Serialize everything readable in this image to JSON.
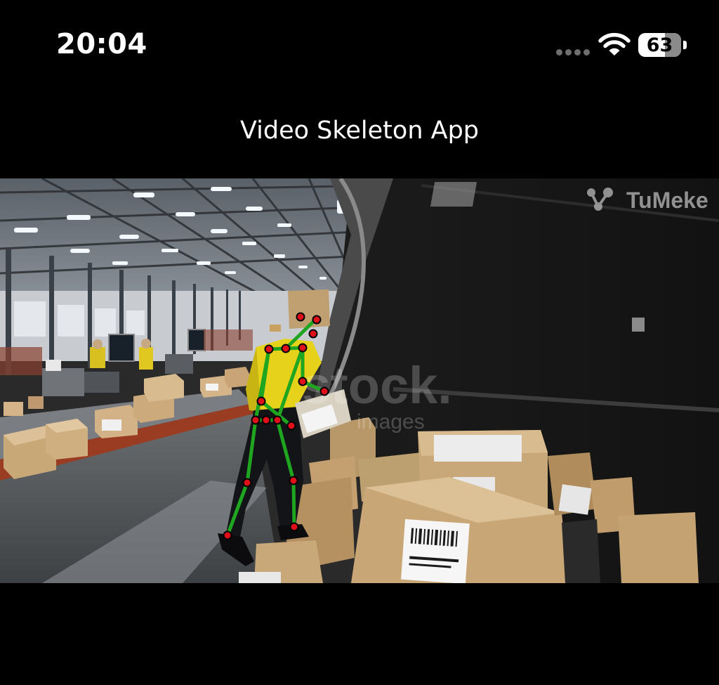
{
  "status_bar": {
    "time": "20:04",
    "battery_level": "63",
    "battery_percent": 63,
    "signal_icon": "cellular-signal-dots-icon",
    "wifi_icon": "wifi-icon",
    "battery_icon": "battery-icon"
  },
  "header": {
    "title": "Video Skeleton App"
  },
  "video": {
    "watermark": "TuMeke",
    "stock_watermark_line1": "stock.",
    "stock_watermark_line2": "images",
    "skeleton_line_color": "#1fa51f",
    "keypoint_fill_color": "#e0101a",
    "keypoint_stroke_color": "#000000"
  }
}
